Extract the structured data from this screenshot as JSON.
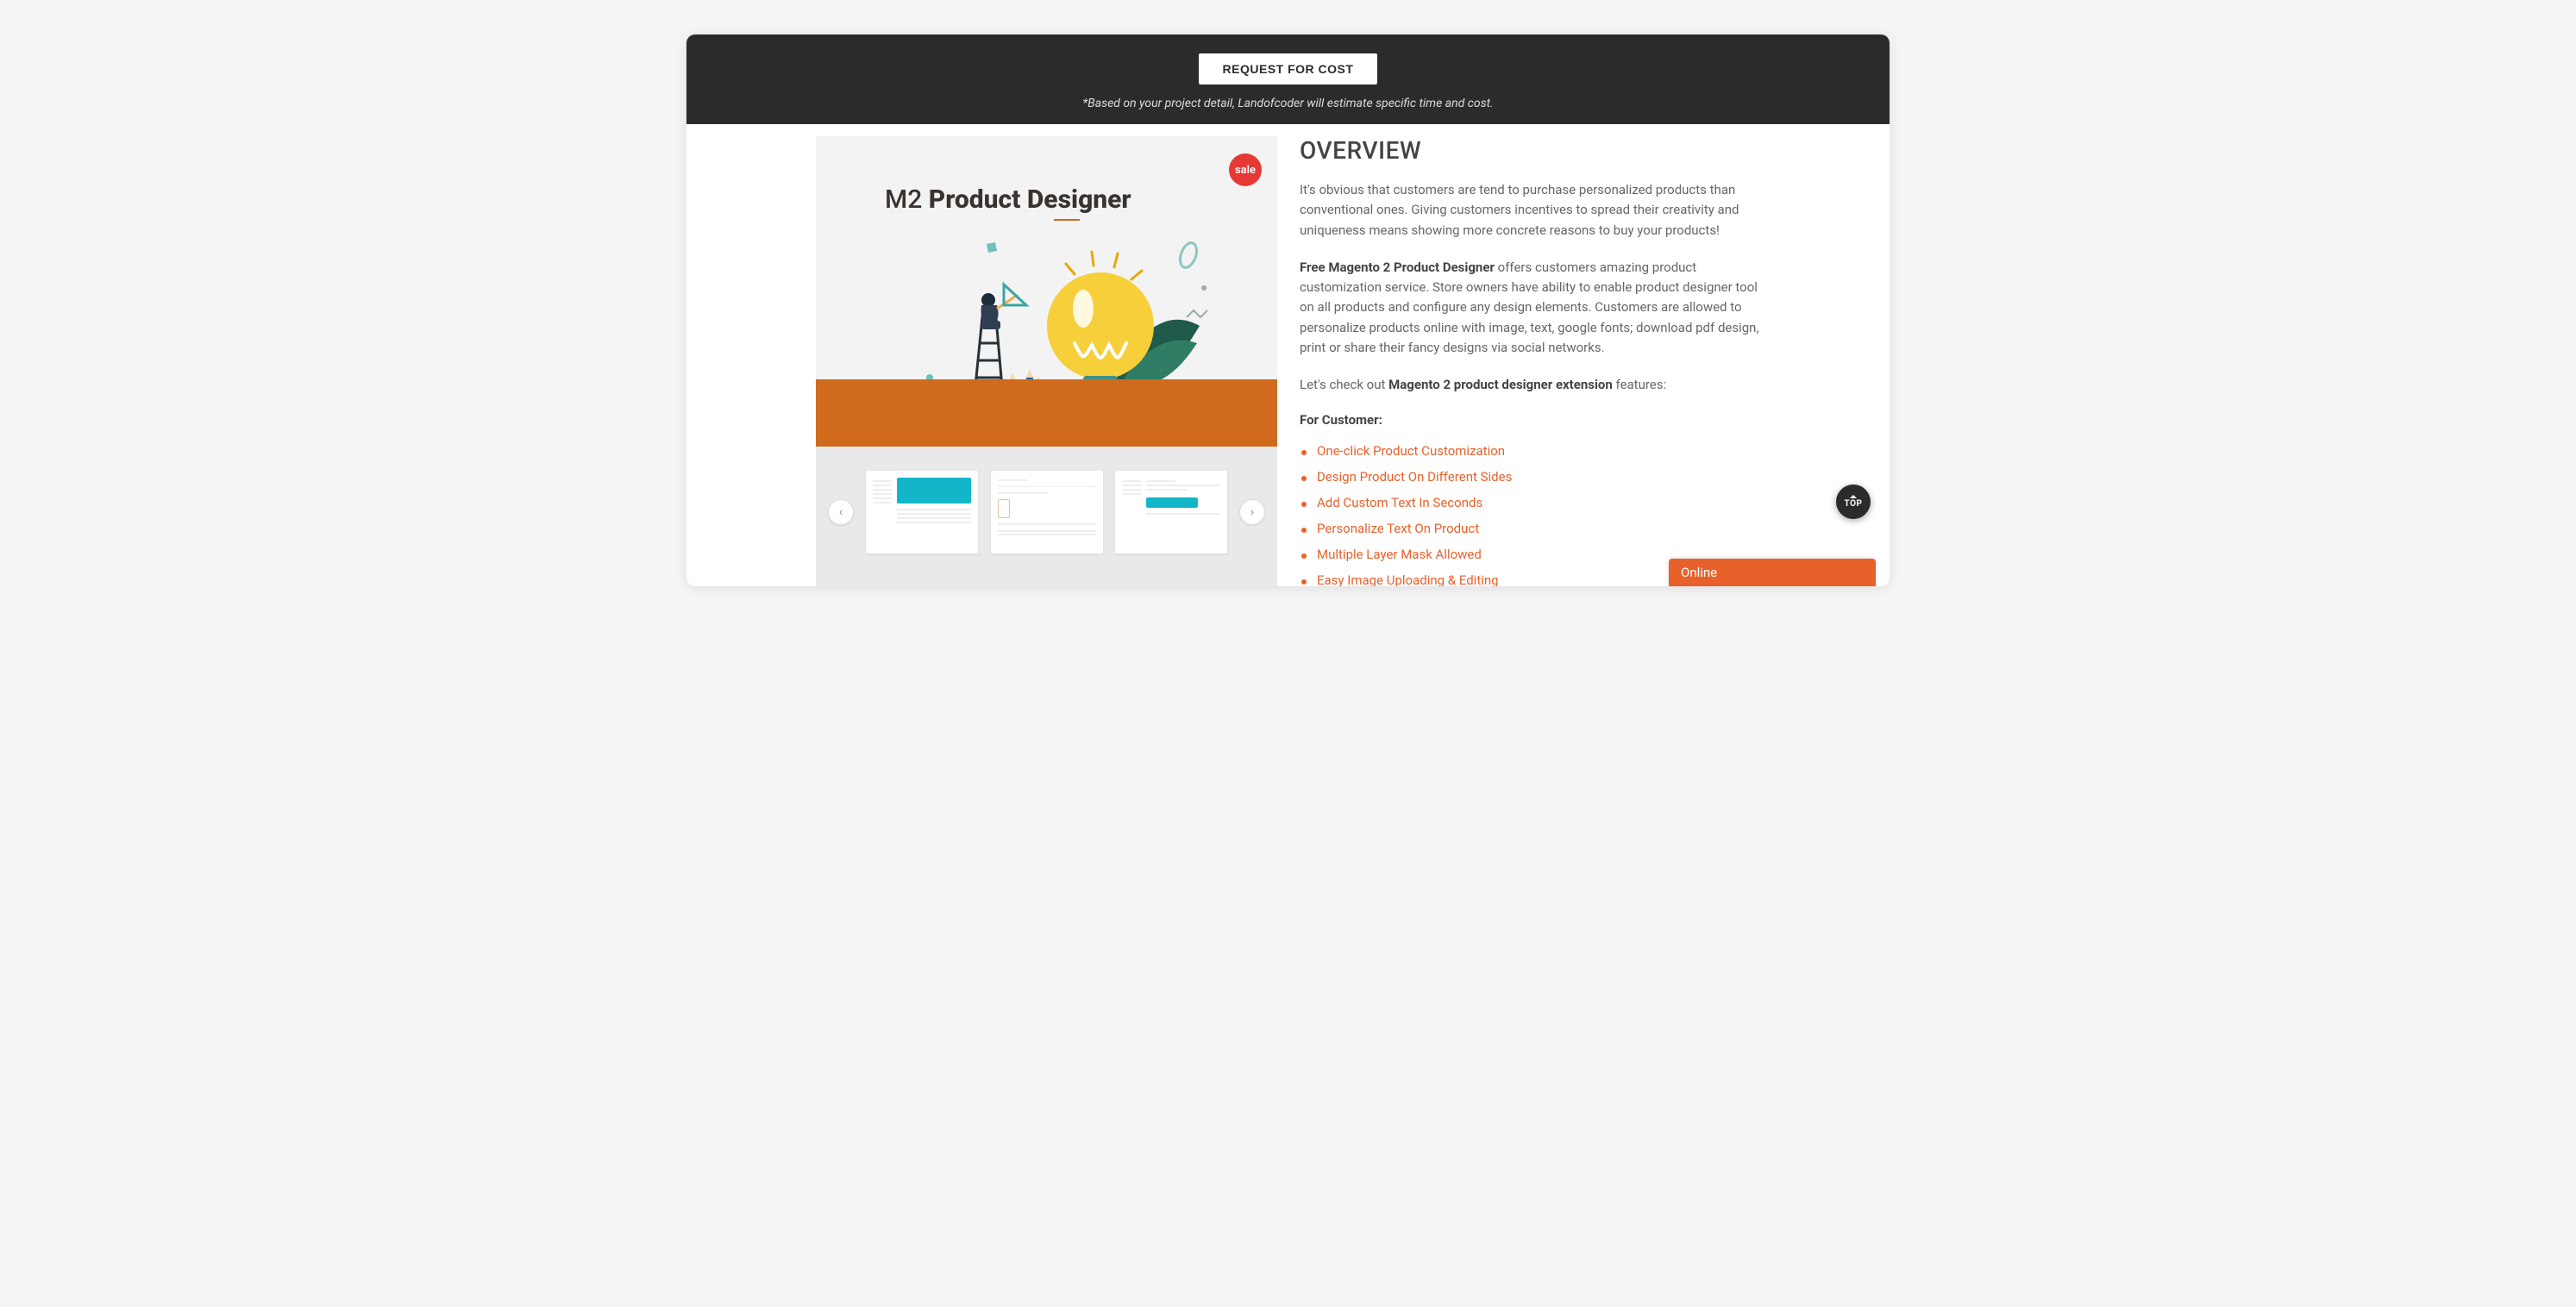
{
  "header": {
    "request_label": "REQUEST FOR COST",
    "note": "*Based on your project detail, Landofcoder will estimate specific time and cost."
  },
  "hero": {
    "title_prefix": "M2 ",
    "title_strong": "Product Designer",
    "sale_label": "sale"
  },
  "overview": {
    "heading": "OVERVIEW",
    "intro": "It's obvious that customers are tend to purchase personalized products than conventional ones. Giving customers incentives to spread their creativity and uniqueness means showing more concrete reasons to buy your products!",
    "desc_prefix_bold": "Free Magento 2 Product Designer",
    "desc_rest": " offers customers amazing product customization service. Store owners have ability to enable product designer tool on all products and configure any design elements. Customers are allowed to personalize products online with image, text, google fonts; download pdf design, print or share their fancy designs via social networks.",
    "check_prefix": "Let's check out ",
    "check_bold": "Magento 2 product designer extension",
    "check_suffix": " features:",
    "for_customer": "For Customer:",
    "features": [
      "One-click Product Customization",
      "Design Product On Different Sides",
      "Add Custom Text In Seconds",
      "Personalize Text On Product",
      "Multiple Layer Mask Allowed",
      "Easy Image Uploading & Editing"
    ]
  },
  "chat": {
    "label": "Online"
  },
  "to_top": {
    "label": "TOP"
  },
  "colors": {
    "accent": "#e8602a",
    "sale": "#e53935",
    "dark": "#2b2b2b",
    "ground": "#d06a1d"
  }
}
